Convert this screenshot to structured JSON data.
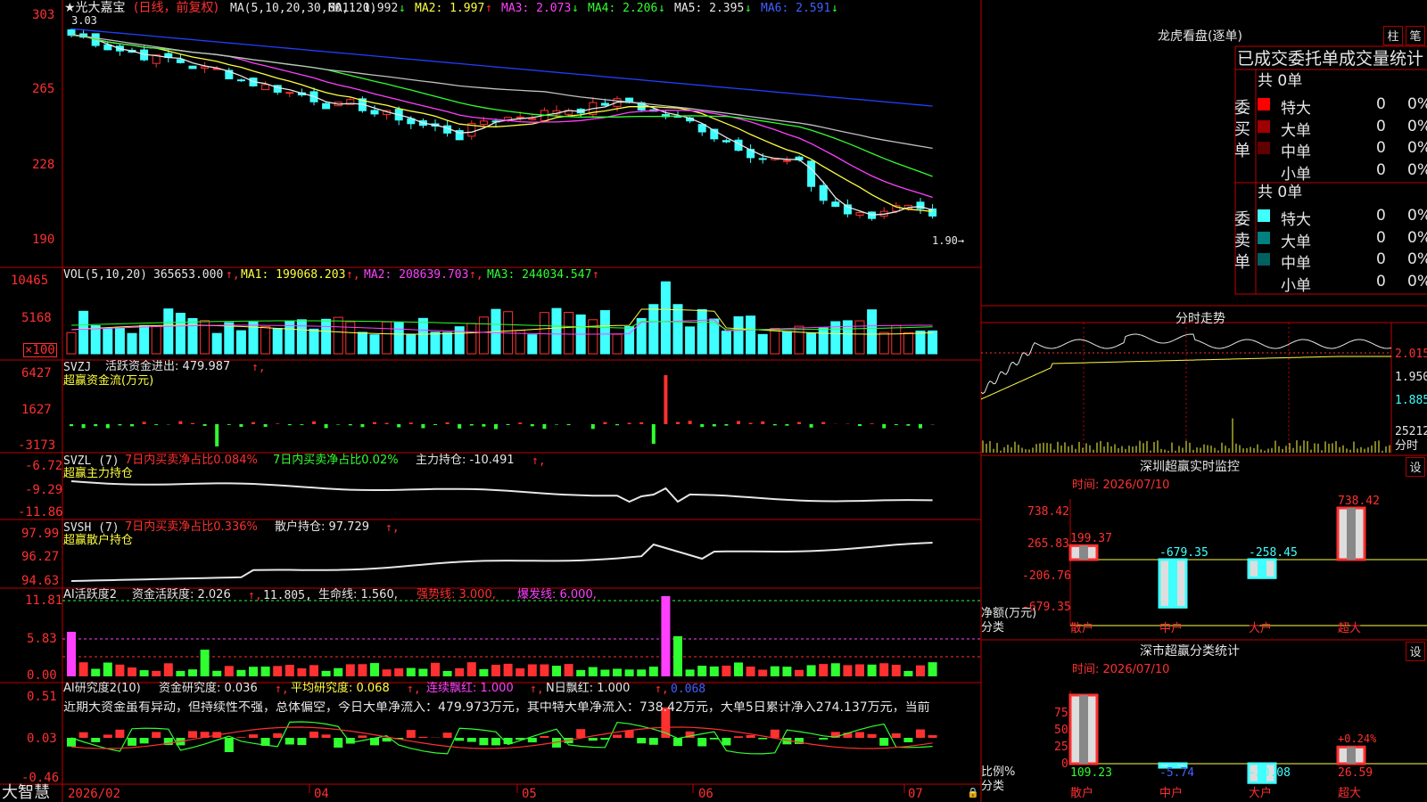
{
  "app": {
    "logo": "大智慧",
    "stock_title": "★光大嘉宝",
    "period": "(日线，前复权)"
  },
  "kline": {
    "ma_header": "MA(5,10,20,30,60,120)",
    "ma_values": [
      {
        "label": "MA1: 1.992",
        "arrow": "↓",
        "color": "#e6e6e6"
      },
      {
        "label": "MA2: 1.997",
        "arrow": "↑",
        "color": "#ffff40"
      },
      {
        "label": "MA3: 2.073",
        "arrow": "↓",
        "color": "#ff40ff"
      },
      {
        "label": "MA4: 2.206",
        "arrow": "↓",
        "color": "#30ff30"
      },
      {
        "label": "MA5: 2.395",
        "arrow": "↓",
        "color": "#e6e6e6"
      },
      {
        "label": "MA6: 2.591",
        "arrow": "↓",
        "color": "#4060ff"
      }
    ],
    "yticks": [
      "303",
      "265",
      "228",
      "190"
    ],
    "high_label": "3.03",
    "low_label": "1.90→"
  },
  "vol": {
    "header": "VOL(5,10,20)",
    "value": "365653.000",
    "ma1": "MA1: 199068.203",
    "ma2": "MA2: 208639.703",
    "ma3": "MA3: 244034.547",
    "yticks": [
      "10465",
      "5168",
      "×100"
    ]
  },
  "svzj": {
    "header": "SVZJ",
    "label": "活跃资金进出: 479.987",
    "sub": "超赢资金流(万元)",
    "yticks": [
      "6427",
      "1627",
      "-3173"
    ]
  },
  "svzl": {
    "header": "SVZL (7)",
    "a": "7日内买卖净占比0.084%",
    "b": "7日内买卖净占比0.02%",
    "c": "主力持仓: -10.491",
    "sub": "超赢主力持仓",
    "yticks": [
      "-6.72",
      "-9.29",
      "-11.86"
    ]
  },
  "svsh": {
    "header": "SVSH (7)",
    "a": "7日内买卖净占比0.336%",
    "c": "散户持仓: 97.729",
    "sub": "超赢散户持仓",
    "yticks": [
      "97.99",
      "96.27",
      "94.63"
    ]
  },
  "ai1": {
    "header": "AI活跃度2",
    "a": "资金活跃度: 2.026",
    "b": "11.805,",
    "c": "生命线: 1.560,",
    "d": "强势线: 3.000,",
    "e": "爆发线: 6.000,",
    "yticks": [
      "11.81",
      "5.83",
      "0.00"
    ]
  },
  "ai2": {
    "header": "AI研究度2(10)",
    "a": "资金研究度: 0.036",
    "b": "平均研究度: 0.068",
    "c": "连续飘红: 1.000",
    "d": "N日飘红: 1.000",
    "e": "0.068",
    "note": "近期大资金虽有异动，但持续性不强，总体偏空，今日大单净流入：479.973万元，其中特大单净流入：738.42万元，大单5日累计净入274.137万元，当前",
    "yticks": [
      "0.51",
      "0.03",
      "-0.46"
    ]
  },
  "dates": [
    "2026/02",
    "04",
    "05",
    "06",
    "07"
  ],
  "lhb": {
    "title": "龙虎看盘(逐单)",
    "btn1": "柱",
    "btn2": "笔",
    "subtitle": "已成交委托单成交量统计",
    "buy_label": "委买单",
    "sell_label": "委卖单",
    "buy_total": "共 0单",
    "sell_total": "共 0单",
    "buy_rows": [
      {
        "n": "特大",
        "v": "0",
        "p": "0%",
        "c": "#ff0000"
      },
      {
        "n": "大单",
        "v": "0",
        "p": "0%",
        "c": "#a00000"
      },
      {
        "n": "中单",
        "v": "0",
        "p": "0%",
        "c": "#600000"
      },
      {
        "n": "小单",
        "v": "0",
        "p": "0%",
        "c": "#000000"
      }
    ],
    "sell_rows": [
      {
        "n": "特大",
        "v": "0",
        "p": "0%",
        "c": "#40ffff"
      },
      {
        "n": "大单",
        "v": "0",
        "p": "0%",
        "c": "#008080"
      },
      {
        "n": "中单",
        "v": "0",
        "p": "0%",
        "c": "#006060"
      },
      {
        "n": "小单",
        "v": "0",
        "p": "0%",
        "c": "#000000"
      }
    ]
  },
  "intraday": {
    "title": "分时走势",
    "yticks": [
      "2.015",
      "1.950",
      "1.885"
    ],
    "vol_label": "25212",
    "vol_unit": "分时"
  },
  "sz_monitor": {
    "title": "深圳超赢实时监控",
    "btn": "设",
    "time": "时间: 2026/07/10",
    "yticks": [
      "738.42",
      "265.83",
      "-206.76",
      "-679.35"
    ],
    "ylabel": "净额(万元)",
    "xlabel": "分类",
    "categories": [
      "散户",
      "中户",
      "大户",
      "超大"
    ],
    "values": [
      199.37,
      -679.35,
      -258.45,
      738.42
    ],
    "value_labels": [
      "199.37",
      "-679.35",
      "-258.45",
      "738.42"
    ]
  },
  "sz_class": {
    "title": "深市超赢分类统计",
    "btn": "设",
    "time": "时间: 2026/07/10",
    "yticks": [
      "75",
      "50",
      "25",
      "0"
    ],
    "ylabel": "比例%",
    "xlabel": "分类",
    "categories": [
      "散户",
      "中户",
      "大户",
      "超大"
    ],
    "values": [
      109.23,
      -5.74,
      -30.08,
      26.59
    ],
    "value_labels": [
      "109.23",
      "-5.74",
      "-30.08",
      "26.59"
    ],
    "extra": "+0.24%"
  },
  "chart_data": {
    "type": "bar",
    "title": "深圳超赢实时监控",
    "categories": [
      "散户",
      "中户",
      "大户",
      "超大"
    ],
    "series": [
      {
        "name": "净额(万元)",
        "values": [
          199.37,
          -679.35,
          -258.45,
          738.42
        ]
      },
      {
        "name": "比例%",
        "values": [
          109.23,
          -5.74,
          -30.08,
          26.59
        ]
      }
    ],
    "ylim": [
      -679.35,
      738.42
    ]
  },
  "colors": {
    "up": "#ff3030",
    "down": "#40ffff",
    "grid": "#a00000"
  }
}
